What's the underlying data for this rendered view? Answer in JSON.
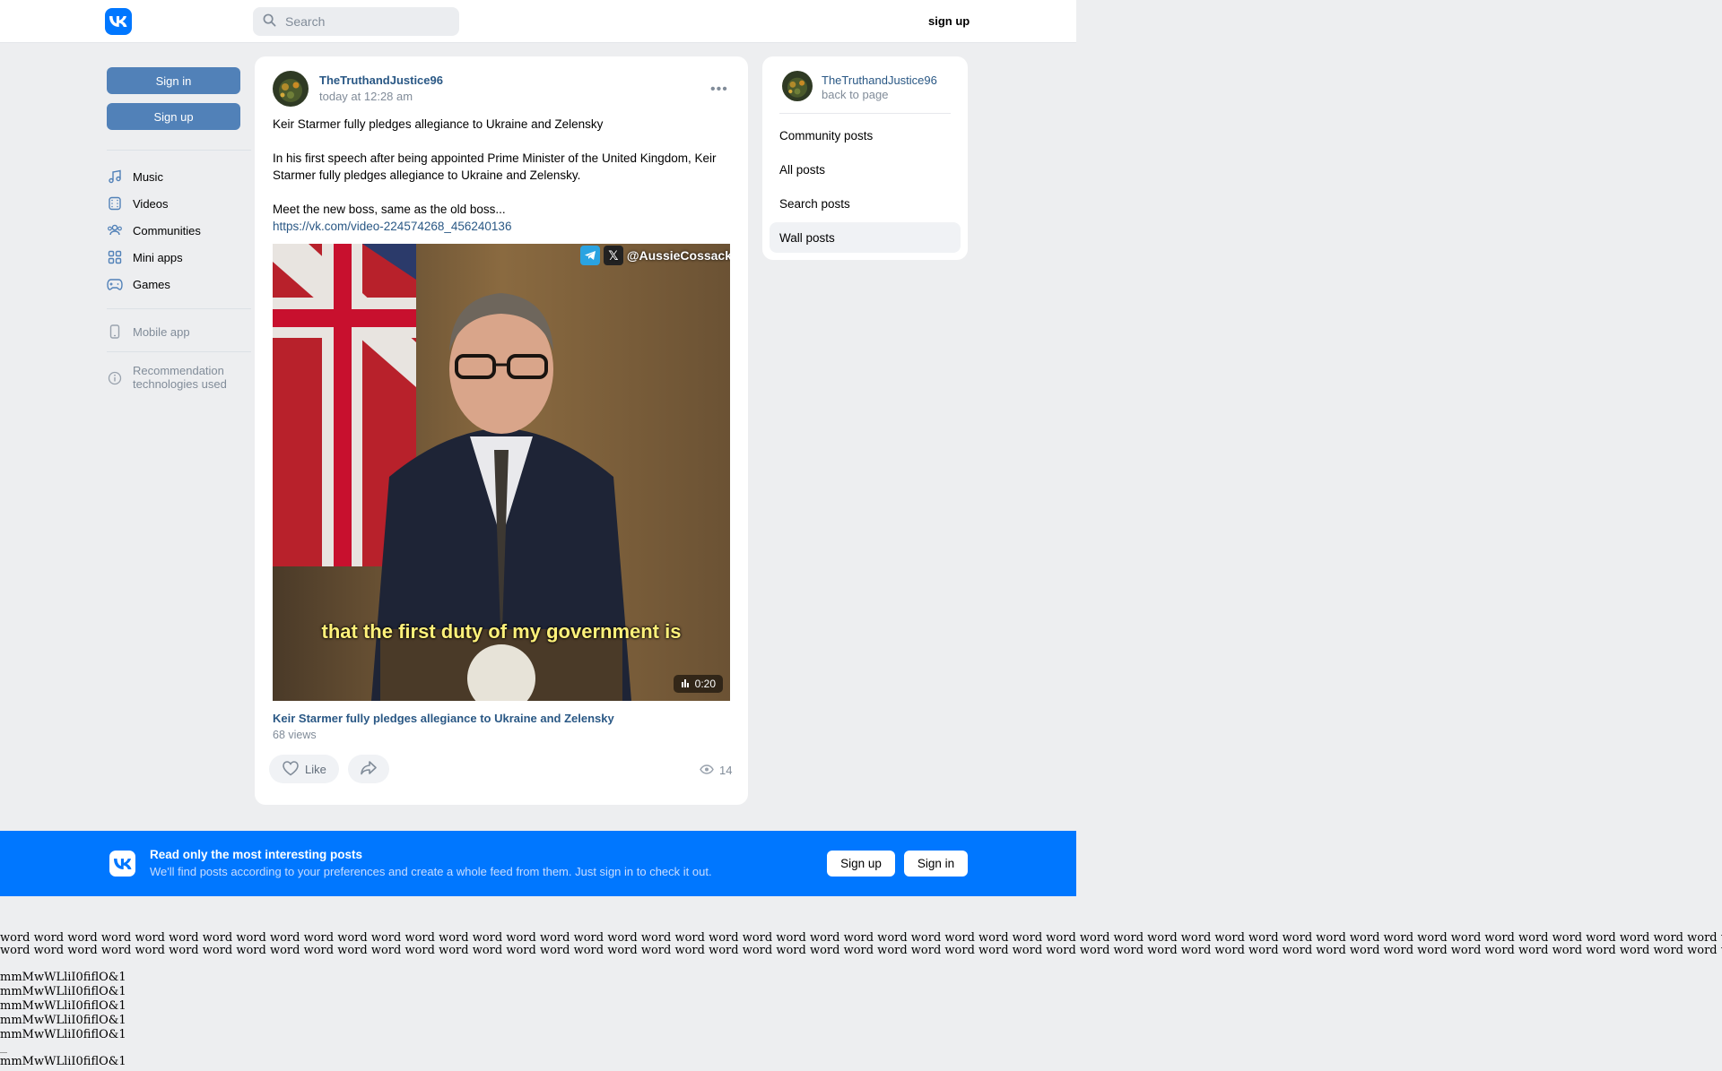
{
  "header": {
    "search_placeholder": "Search",
    "signup_label": "sign up"
  },
  "sidebar": {
    "signin_label": "Sign in",
    "signup_label": "Sign up",
    "items": [
      {
        "label": "Music",
        "icon": "music-note-icon"
      },
      {
        "label": "Videos",
        "icon": "video-icon"
      },
      {
        "label": "Communities",
        "icon": "users-icon"
      },
      {
        "label": "Mini apps",
        "icon": "apps-grid-icon"
      },
      {
        "label": "Games",
        "icon": "gamepad-icon"
      }
    ],
    "mobile_app_label": "Mobile app",
    "recommendation_label_1": "Recommendation",
    "recommendation_label_2": "technologies used"
  },
  "post": {
    "author": "TheTruthandJustice96",
    "date": "today at 12:28 am",
    "text_title": "Keir Starmer fully pledges allegiance to Ukraine and Zelensky",
    "text_body": "In his first speech after being appointed Prime Minister of the United Kingdom, Keir Starmer fully pledges allegiance to Ukraine and Zelensky.",
    "text_tail": "Meet the new boss, same as the old boss...",
    "link": "https://vk.com/video-224574268_456240136",
    "video": {
      "watermark": "@AussieCossack",
      "subtitle": "that the first duty of my government is",
      "duration": "0:20",
      "title": "Keir Starmer fully pledges allegiance to Ukraine and Zelensky",
      "views": "68 views"
    },
    "like_label": "Like",
    "view_count": "14"
  },
  "right_panel": {
    "author": "TheTruthandJustice96",
    "back_label": "back to page",
    "items": [
      "Community posts",
      "All posts",
      "Search posts",
      "Wall posts"
    ],
    "active_item": "Wall posts"
  },
  "banner": {
    "title": "Read only the most interesting posts",
    "text": "We'll find posts according to your preferences and create a whole feed from them. Just sign in to check it out.",
    "signup_label": "Sign up",
    "signin_label": "Sign in"
  },
  "footer_test": {
    "word_line": "word word word word word word word word word word word word word word word word word word word word word word word word word word word word word word word word word word word word word word word word word word word word word word word word word word word word word word word word word word word word word word word word word word",
    "glyphs": [
      "mmMwWLliI0fiflO&1",
      "mmMwWLliI0fiflO&1",
      "mmMwWLliI0fiflO&1",
      "mmMwWLliI0fiflO&1",
      "mmMwWLliI0fiflO&1",
      "mmMwWLliI0fiflO&1"
    ]
  },
  "colors": {
    "accent": "#0077ff",
    "button_blue": "#5181b8",
    "link": "#2a5885",
    "background": "#edeef0"
  }
}
